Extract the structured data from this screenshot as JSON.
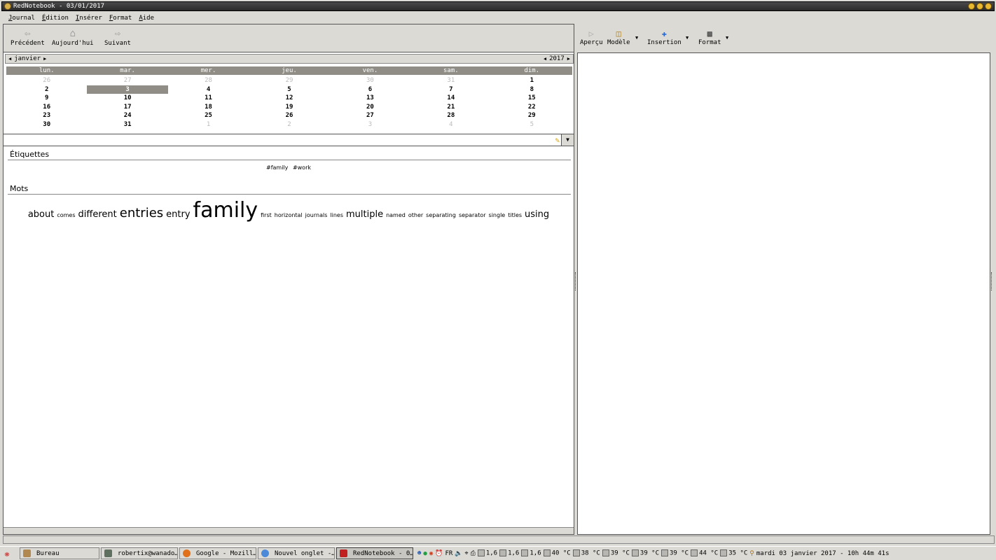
{
  "window": {
    "title": "RedNotebook - 03/01/2017"
  },
  "menubar": {
    "items": [
      "Journal",
      "Édition",
      "Insérer",
      "Format",
      "Aide"
    ]
  },
  "nav_toolbar": {
    "previous": "Précédent",
    "today": "Aujourd'hui",
    "next": "Suivant"
  },
  "calendar": {
    "month": "janvier",
    "year": "2017",
    "weekdays": [
      "lun.",
      "mar.",
      "mer.",
      "jeu.",
      "ven.",
      "sam.",
      "dim."
    ],
    "selected_day": "3",
    "weeks": [
      [
        {
          "d": "26",
          "o": true
        },
        {
          "d": "27",
          "o": true
        },
        {
          "d": "28",
          "o": true
        },
        {
          "d": "29",
          "o": true
        },
        {
          "d": "30",
          "o": true
        },
        {
          "d": "31",
          "o": true
        },
        {
          "d": "1",
          "o": false
        }
      ],
      [
        {
          "d": "2",
          "o": false
        },
        {
          "d": "3",
          "o": false
        },
        {
          "d": "4",
          "o": false
        },
        {
          "d": "5",
          "o": false
        },
        {
          "d": "6",
          "o": false
        },
        {
          "d": "7",
          "o": false
        },
        {
          "d": "8",
          "o": false
        }
      ],
      [
        {
          "d": "9",
          "o": false
        },
        {
          "d": "10",
          "o": false
        },
        {
          "d": "11",
          "o": false
        },
        {
          "d": "12",
          "o": false
        },
        {
          "d": "13",
          "o": false
        },
        {
          "d": "14",
          "o": false
        },
        {
          "d": "15",
          "o": false
        }
      ],
      [
        {
          "d": "16",
          "o": false
        },
        {
          "d": "17",
          "o": false
        },
        {
          "d": "18",
          "o": false
        },
        {
          "d": "19",
          "o": false
        },
        {
          "d": "20",
          "o": false
        },
        {
          "d": "21",
          "o": false
        },
        {
          "d": "22",
          "o": false
        }
      ],
      [
        {
          "d": "23",
          "o": false
        },
        {
          "d": "24",
          "o": false
        },
        {
          "d": "25",
          "o": false
        },
        {
          "d": "26",
          "o": false
        },
        {
          "d": "27",
          "o": false
        },
        {
          "d": "28",
          "o": false
        },
        {
          "d": "29",
          "o": false
        }
      ],
      [
        {
          "d": "30",
          "o": false
        },
        {
          "d": "31",
          "o": false
        },
        {
          "d": "1",
          "o": true
        },
        {
          "d": "2",
          "o": true
        },
        {
          "d": "3",
          "o": true
        },
        {
          "d": "4",
          "o": true
        },
        {
          "d": "5",
          "o": true
        }
      ]
    ]
  },
  "search": {
    "value": ""
  },
  "tags": {
    "title": "Étiquettes",
    "items": [
      "#family",
      "#work"
    ]
  },
  "words": {
    "title": "Mots",
    "items": [
      {
        "w": "about",
        "size": 13
      },
      {
        "w": "comes",
        "size": 8
      },
      {
        "w": "different",
        "size": 13
      },
      {
        "w": "entries",
        "size": 18
      },
      {
        "w": "entry",
        "size": 13
      },
      {
        "w": "family",
        "size": 30
      },
      {
        "w": "first",
        "size": 8
      },
      {
        "w": "horizontal",
        "size": 8
      },
      {
        "w": "journals",
        "size": 8
      },
      {
        "w": "lines",
        "size": 8
      },
      {
        "w": "multiple",
        "size": 13
      },
      {
        "w": "named",
        "size": 8
      },
      {
        "w": "other",
        "size": 8
      },
      {
        "w": "separating",
        "size": 8
      },
      {
        "w": "separator",
        "size": 8
      },
      {
        "w": "single",
        "size": 8
      },
      {
        "w": "titles",
        "size": 8
      },
      {
        "w": "using",
        "size": 13
      }
    ]
  },
  "editor_toolbar": {
    "preview": "Aperçu",
    "template": "Modèle",
    "insert": "Insertion",
    "format": "Format"
  },
  "taskbar": {
    "tasks": [
      {
        "label": "Bureau",
        "color": "#b08850"
      },
      {
        "label": "robertix@wanado…",
        "color": "#607060"
      },
      {
        "label": "Google - Mozill…",
        "color": "#e0701a"
      },
      {
        "label": "Nouvel onglet -…",
        "color": "#4a8ad8"
      },
      {
        "label": "RedNotebook - 0…",
        "color": "#c02020"
      }
    ],
    "lang": "FR",
    "readings": [
      "1,6",
      "1,6",
      "1,6",
      "40 °C",
      "38 °C",
      "39 °C",
      "39 °C",
      "39 °C",
      "44 °C",
      "35 °C"
    ],
    "clock": "mardi 03 janvier 2017 - 10h 44m 41s"
  }
}
